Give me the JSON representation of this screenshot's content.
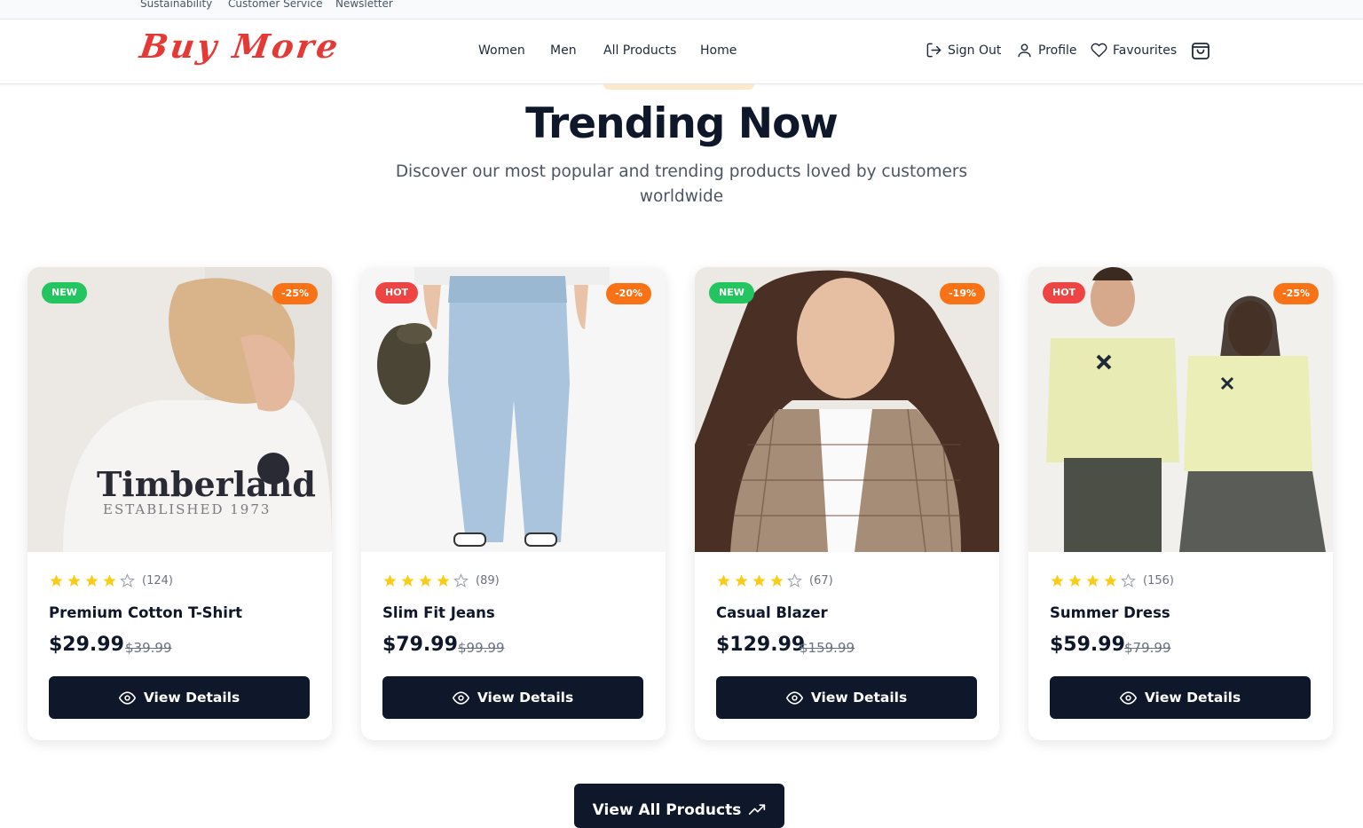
{
  "topbar": {
    "links": [
      "Sustainability",
      "Customer Service",
      "Newsletter"
    ]
  },
  "header": {
    "logo": "Buy More",
    "nav": [
      "Women",
      "Men",
      "All Products",
      "Home"
    ],
    "actions": {
      "sign_out": "Sign Out",
      "profile": "Profile",
      "favourites": "Favourites"
    }
  },
  "section": {
    "title": "Trending Now",
    "subtitle": "Discover our most popular and trending products loved by customers worldwide"
  },
  "products": [
    {
      "name": "Premium Cotton T-Shirt",
      "price": "$29.99",
      "old_price": "$39.99",
      "badge": "NEW",
      "discount": "-25%",
      "rating": 4,
      "reviews": "(124)",
      "button": "View Details"
    },
    {
      "name": "Slim Fit Jeans",
      "price": "$79.99",
      "old_price": "$99.99",
      "badge": "HOT",
      "discount": "-20%",
      "rating": 4,
      "reviews": "(89)",
      "button": "View Details"
    },
    {
      "name": "Casual Blazer",
      "price": "$129.99",
      "old_price": "$159.99",
      "badge": "NEW",
      "discount": "-19%",
      "rating": 4,
      "reviews": "(67)",
      "button": "View Details"
    },
    {
      "name": "Summer Dress",
      "price": "$59.99",
      "old_price": "$79.99",
      "badge": "HOT",
      "discount": "-25%",
      "rating": 4,
      "reviews": "(156)",
      "button": "View Details"
    }
  ],
  "photo_text": {
    "brand": "Timberland",
    "established": "ESTABLISHED 1973"
  },
  "view_all": "View All Products",
  "colors": {
    "new_badge": "#22c55e",
    "hot_badge": "#ef4444",
    "discount_badge": "#f97316",
    "star": "#facc15",
    "button": "#0f172a",
    "logo": "#e53935"
  }
}
